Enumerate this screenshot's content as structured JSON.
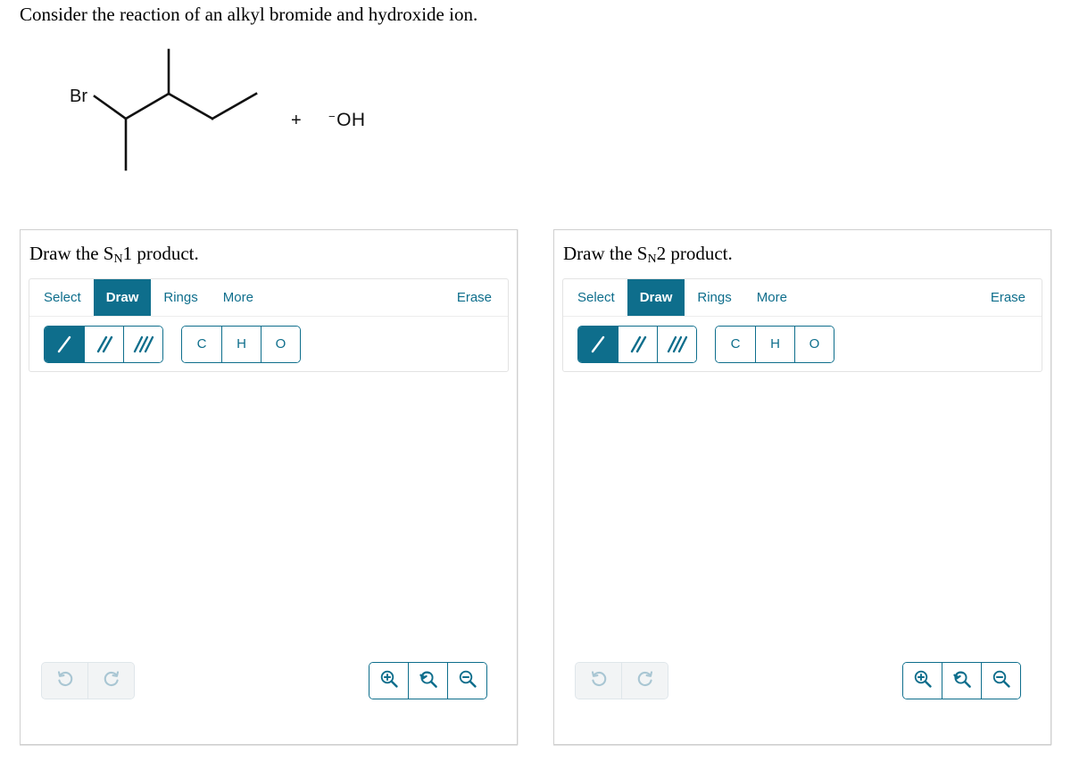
{
  "prompt": {
    "text": "Consider the reaction of an alkyl bromide and hydroxide ion."
  },
  "reaction": {
    "reactant_label": "Br",
    "plus": "+",
    "reagent_charge": "−",
    "reagent_label": "OH",
    "structure_name": "2-bromo-3-methylpentane-skeletal"
  },
  "colors": {
    "accent_teal": "#0e6e8c",
    "panel_border": "#cfcfcf",
    "toolbox_border": "#e3e3e3",
    "disabled_icon": "#a9c6d3",
    "disabled_bg": "#f2f4f5",
    "bond_stroke": "#111111"
  },
  "panels": [
    {
      "id": "sn1",
      "title_prefix": "Draw the S",
      "title_sub": "N",
      "title_number": "1",
      "title_suffix": " product.",
      "tabs": [
        {
          "label": "Select",
          "active": false
        },
        {
          "label": "Draw",
          "active": true
        },
        {
          "label": "Rings",
          "active": false
        },
        {
          "label": "More",
          "active": false
        }
      ],
      "erase_label": "Erase",
      "bond_tools": [
        {
          "icon": "single-bond-icon",
          "selected": true
        },
        {
          "icon": "double-bond-icon",
          "selected": false
        },
        {
          "icon": "triple-bond-icon",
          "selected": false
        }
      ],
      "atom_tools": [
        {
          "label": "C",
          "selected": false
        },
        {
          "label": "H",
          "selected": false
        },
        {
          "label": "O",
          "selected": false
        }
      ],
      "history": [
        {
          "icon": "undo-icon",
          "enabled": false
        },
        {
          "icon": "redo-icon",
          "enabled": false
        }
      ],
      "zoom_controls": [
        {
          "icon": "zoom-in-icon",
          "enabled": true
        },
        {
          "icon": "zoom-reset-icon",
          "enabled": true
        },
        {
          "icon": "zoom-out-icon",
          "enabled": true
        }
      ],
      "canvas_content": ""
    },
    {
      "id": "sn2",
      "title_prefix": "Draw the S",
      "title_sub": "N",
      "title_number": "2",
      "title_suffix": " product.",
      "tabs": [
        {
          "label": "Select",
          "active": false
        },
        {
          "label": "Draw",
          "active": true
        },
        {
          "label": "Rings",
          "active": false
        },
        {
          "label": "More",
          "active": false
        }
      ],
      "erase_label": "Erase",
      "bond_tools": [
        {
          "icon": "single-bond-icon",
          "selected": true
        },
        {
          "icon": "double-bond-icon",
          "selected": false
        },
        {
          "icon": "triple-bond-icon",
          "selected": false
        }
      ],
      "atom_tools": [
        {
          "label": "C",
          "selected": false
        },
        {
          "label": "H",
          "selected": false
        },
        {
          "label": "O",
          "selected": false
        }
      ],
      "history": [
        {
          "icon": "undo-icon",
          "enabled": false
        },
        {
          "icon": "redo-icon",
          "enabled": false
        }
      ],
      "zoom_controls": [
        {
          "icon": "zoom-in-icon",
          "enabled": true
        },
        {
          "icon": "zoom-reset-icon",
          "enabled": true
        },
        {
          "icon": "zoom-out-icon",
          "enabled": true
        }
      ],
      "canvas_content": ""
    }
  ]
}
